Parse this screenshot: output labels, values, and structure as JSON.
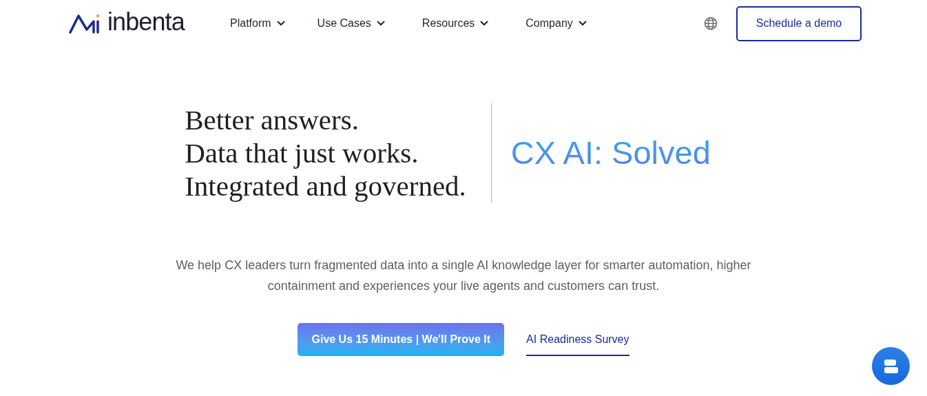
{
  "logo": {
    "text": "inbenta"
  },
  "nav": [
    "Platform",
    "Use Cases",
    "Resources",
    "Company"
  ],
  "header_button": "Schedule a demo",
  "hero": {
    "lines": [
      "Better answers.",
      "Data that just works.",
      "Integrated and governed."
    ],
    "tagline": "CX AI: Solved",
    "description": "We help CX leaders turn fragmented data into a single AI knowledge layer for smarter automation, higher containment and experiences your live agents and customers can trust.",
    "primary_button": "Give Us 15 Minutes | We'll Prove It",
    "secondary_link": "AI Readiness Survey"
  }
}
